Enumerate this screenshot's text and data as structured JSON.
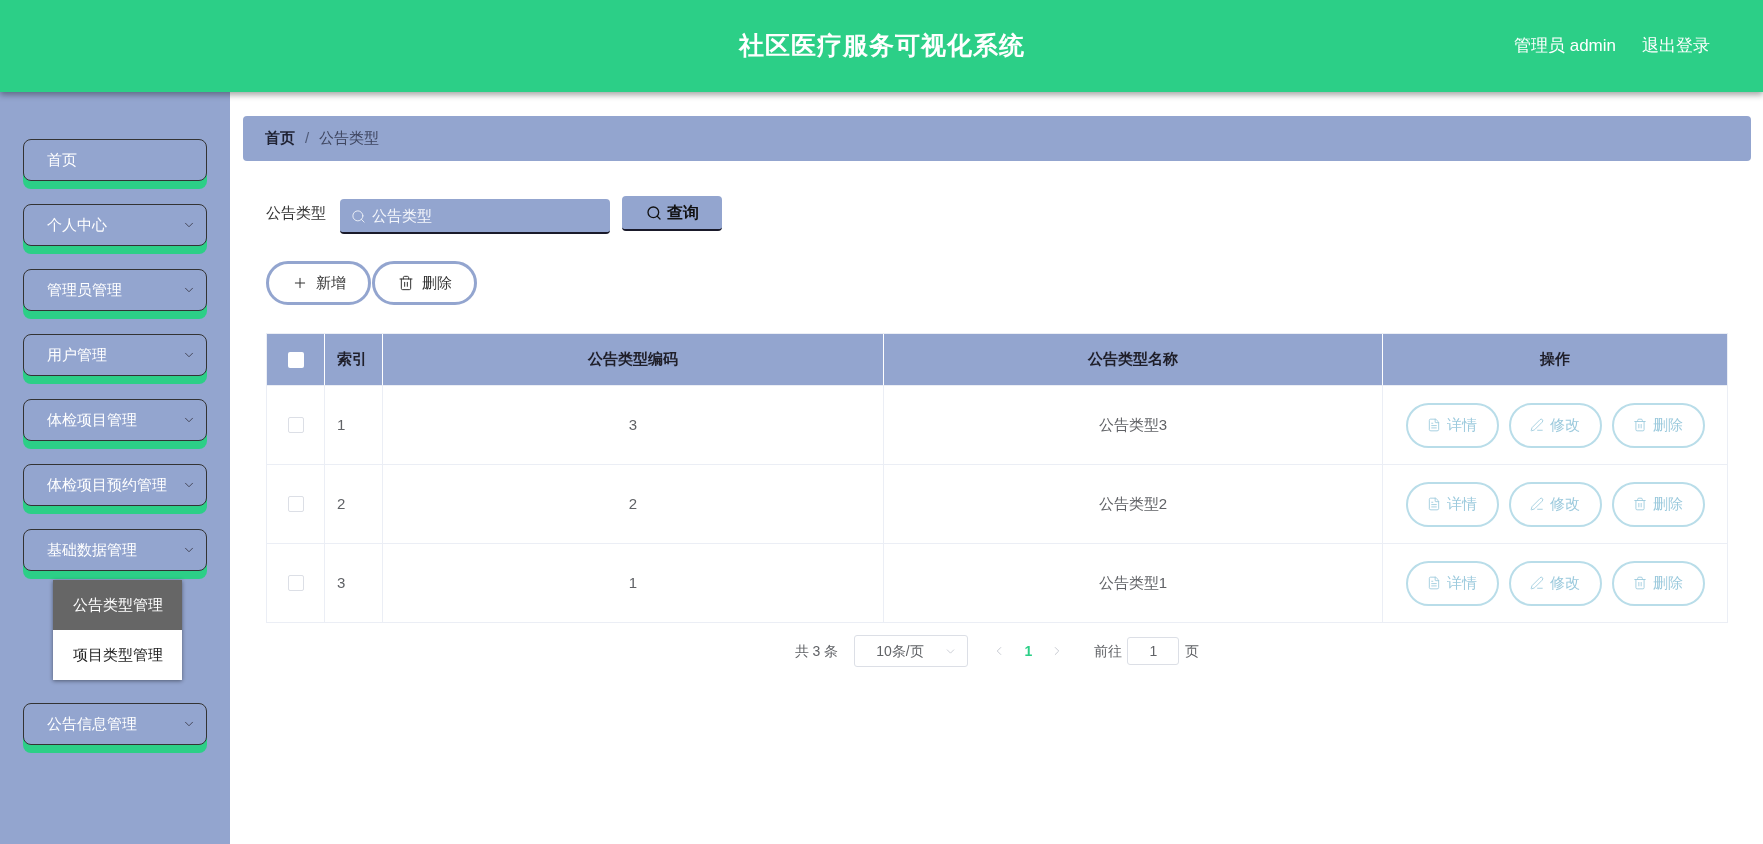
{
  "header": {
    "title": "社区医疗服务可视化系统",
    "user": "管理员 admin",
    "logout": "退出登录"
  },
  "sidebar": {
    "items": [
      {
        "kind": "link",
        "label": "首页"
      },
      {
        "kind": "submenu",
        "label": "个人中心"
      },
      {
        "kind": "submenu",
        "label": "管理员管理"
      },
      {
        "kind": "submenu",
        "label": "用户管理"
      },
      {
        "kind": "submenu",
        "label": "体检项目管理"
      },
      {
        "kind": "submenu",
        "label": "体检项目预约管理"
      },
      {
        "kind": "submenu",
        "label": "基础数据管理",
        "children": [
          {
            "label": "公告类型管理",
            "selected": true
          },
          {
            "label": "项目类型管理",
            "selected": false
          }
        ]
      },
      {
        "kind": "submenu",
        "label": "公告信息管理"
      }
    ]
  },
  "breadcrumb": {
    "separator": "/",
    "items": [
      {
        "label": "首页",
        "current": false
      },
      {
        "label": "公告类型",
        "current": true
      }
    ]
  },
  "search": {
    "label": "公告类型",
    "placeholder": "公告类型",
    "button": "查询"
  },
  "toolbar": [
    {
      "kind": "add",
      "label": "新增"
    },
    {
      "kind": "delete",
      "label": "删除"
    }
  ],
  "table": {
    "select_all": false,
    "columns": [
      "索引",
      "公告类型编码",
      "公告类型名称",
      "操作"
    ],
    "rows": [
      {
        "checked": false,
        "cells": [
          "1",
          "3",
          "公告类型3"
        ],
        "actions": [
          {
            "kind": "detail",
            "label": "详情"
          },
          {
            "kind": "edit",
            "label": "修改"
          },
          {
            "kind": "delete",
            "label": "删除"
          }
        ]
      },
      {
        "checked": false,
        "cells": [
          "2",
          "2",
          "公告类型2"
        ],
        "actions": [
          {
            "kind": "detail",
            "label": "详情"
          },
          {
            "kind": "edit",
            "label": "修改"
          },
          {
            "kind": "delete",
            "label": "删除"
          }
        ]
      },
      {
        "checked": false,
        "cells": [
          "3",
          "1",
          "公告类型1"
        ],
        "actions": [
          {
            "kind": "detail",
            "label": "详情"
          },
          {
            "kind": "edit",
            "label": "修改"
          },
          {
            "kind": "delete",
            "label": "删除"
          }
        ]
      }
    ]
  },
  "pagination": {
    "total": "共 3 条",
    "page_size": "10条/页",
    "pages": [
      {
        "label": "1",
        "selected": true
      }
    ],
    "goto_label": "前往",
    "goto_value": "1",
    "goto_suffix": "页"
  }
}
